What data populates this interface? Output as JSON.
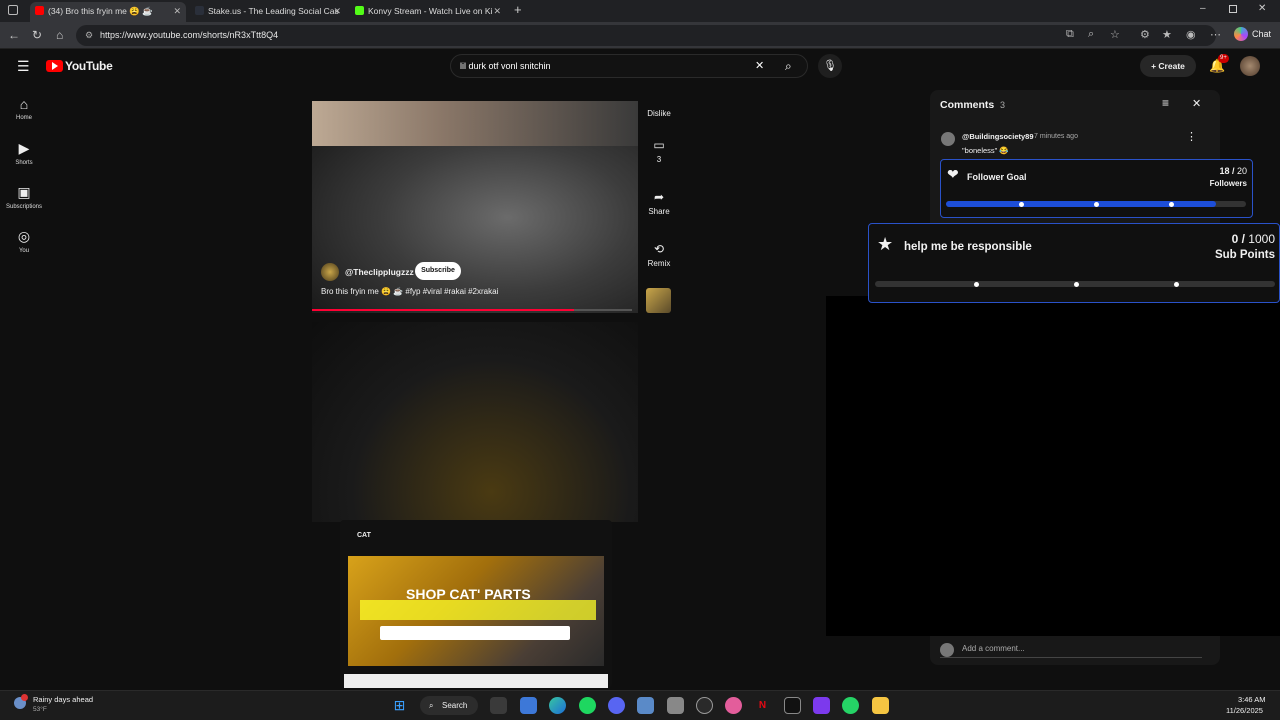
{
  "browser": {
    "tabs": [
      {
        "title": "(34) Bro this fryin me 😩 ☕",
        "active": true
      },
      {
        "title": "Stake.us - The Leading Social Cas",
        "active": false
      },
      {
        "title": "Konvy Stream - Watch Live on Ki",
        "active": false
      }
    ],
    "url": "https://www.youtube.com/shorts/nR3xTtt8Q4"
  },
  "youtube": {
    "logo": "YouTube",
    "search_value": "lil durk otf vonl snitchin",
    "create_label": "Create",
    "notif_badge": "9+",
    "nav": [
      {
        "label": "Home",
        "icon": "home-icon"
      },
      {
        "label": "Shorts",
        "icon": "shorts-icon"
      },
      {
        "label": "Subscriptions",
        "icon": "subscriptions-icon"
      },
      {
        "label": "You",
        "icon": "you-icon"
      }
    ]
  },
  "short": {
    "channel": "@Theclipplugzzz",
    "subscribe_label": "Subscribe",
    "caption": "Bro this fryin me 😩 ☕ #fyp #viral #rakai #2xrakai",
    "progress": 0.82,
    "actions": {
      "dislike_label": "Dislike",
      "comments_count": "3",
      "share_label": "Share",
      "remix_label": "Remix"
    }
  },
  "ad": {
    "brand": "CAT",
    "headline": "SHOP CAT' PARTS"
  },
  "comments": {
    "title": "Comments",
    "count": "3",
    "items": [
      {
        "author": "@Buildingsociety89",
        "time": "7 minutes ago",
        "text": "\"boneless\" 😂"
      }
    ],
    "add_placeholder": "Add a comment..."
  },
  "follower_goal": {
    "title": "Follower Goal",
    "current": "18",
    "target": "20",
    "unit": "Followers",
    "progress": 0.9
  },
  "sub_goal": {
    "title": "help me be responsible",
    "current": "0",
    "target": "1000",
    "unit": "Sub Points",
    "progress": 0.0
  },
  "taskbar": {
    "weather_title": "Rainy days ahead",
    "weather_temp": "53°F",
    "search_label": "Search",
    "time": "3:46 AM",
    "date": "11/26/2025"
  }
}
